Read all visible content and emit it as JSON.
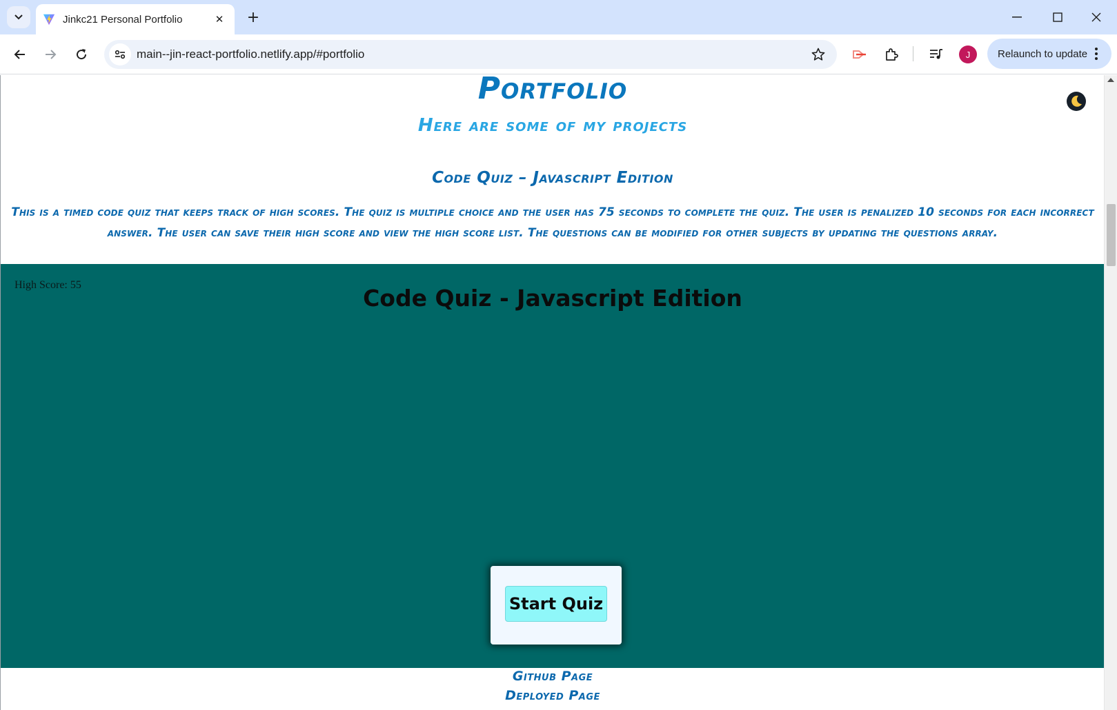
{
  "browser": {
    "tab_title": "Jinkc21 Personal Portfolio",
    "url": "main--jin-react-portfolio.netlify.app/#portfolio",
    "relaunch_label": "Relaunch to update",
    "profile_initial": "J"
  },
  "page": {
    "heading": "Portfolio",
    "subheading": "Here are some of my projects",
    "project": {
      "title": "Code Quiz – Javascript Edition",
      "description": "This is a timed code quiz that keeps track of high scores. The quiz is multiple choice and the user has 75 seconds to complete the quiz. The user is penalized 10 seconds for each incorrect answer. The user can save their high score and view the high score list. The questions can be modified for other subjects by updating the questions array.",
      "demo": {
        "high_score_label": "High Score: 55",
        "title": "Code Quiz - Javascript Edition",
        "start_button": "Start Quiz"
      },
      "links": {
        "github": "Github Page",
        "deployed": "Deployed Page"
      }
    },
    "theme_toggle_icon": "moon-icon"
  }
}
